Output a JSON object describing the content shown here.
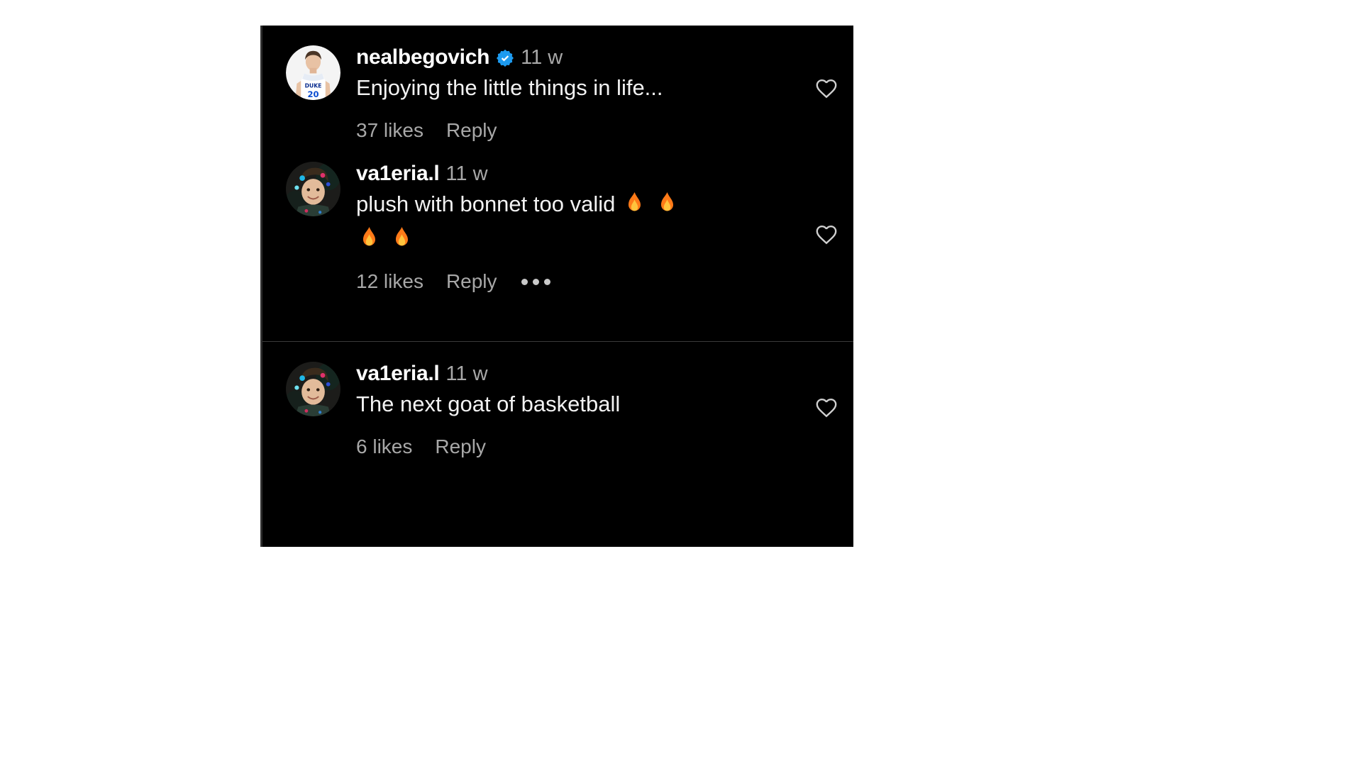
{
  "panel": {
    "background_color": "#000000",
    "page_background_color": "#ffffff",
    "accent_verified_color": "#1d9bf0",
    "muted_text_color": "#a8a8a8",
    "text_color": "#f2f2f2"
  },
  "comments": [
    {
      "username": "nealbegovich",
      "verified": true,
      "timestamp": "11 w",
      "text": "Enjoying the little things in life...",
      "likes": "37 likes",
      "reply": "Reply",
      "has_more_options": false,
      "avatar_name": "avatar-nealbegovich",
      "like_icon_name": "heart-icon"
    },
    {
      "username": "va1eria.l",
      "verified": false,
      "timestamp": "11 w",
      "text": "plush with bonnet too valid",
      "emoji_count": 4,
      "emoji_name": "fire-emoji",
      "likes": "12 likes",
      "reply": "Reply",
      "has_more_options": true,
      "more_options_label": "more-options",
      "avatar_name": "avatar-va1eria-l",
      "like_icon_name": "heart-icon"
    },
    {
      "username": "va1eria.l",
      "verified": false,
      "timestamp": "11 w",
      "text": "The next goat of basketball",
      "likes": "6 likes",
      "reply": "Reply",
      "has_more_options": false,
      "avatar_name": "avatar-va1eria-l",
      "like_icon_name": "heart-icon"
    }
  ]
}
